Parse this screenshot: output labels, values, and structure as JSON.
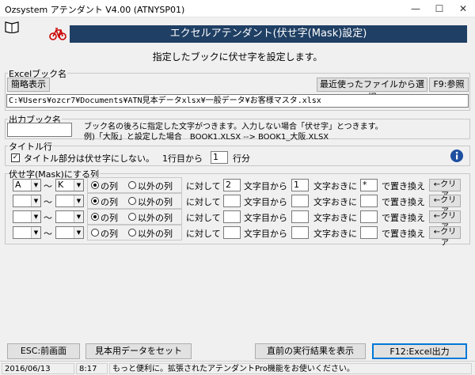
{
  "window": {
    "title": "Ozsystem アテンダント V4.00 (ATNYSP01)"
  },
  "banner": {
    "title": "エクセルアテンダント(伏せ字(Mask)設定)",
    "subtitle": "指定したブックに伏せ字を設定します。"
  },
  "excel_book": {
    "label": "Excelブック名",
    "simple_view_label": "簡略表示",
    "recent_label": "最近使ったファイルから選択",
    "browse_label": "F9:参照",
    "path": "C:¥Users¥ozcr7¥Documents¥ATN見本データxlsx¥一般データ¥お客様マスタ.xlsx"
  },
  "output_book": {
    "label": "出力ブック名",
    "value": "",
    "hint1": "ブック名の後ろに指定した文字がつきます。入力しない場合「伏せ字」とつきます。",
    "hint2": "例)「大阪」と設定した場合　BOOK1.XLSX --> BOOK1_大阪.XLSX"
  },
  "title_row": {
    "label": "タイトル行",
    "checkbox_label": "タイトル部分は伏せ字にしない。",
    "checked": true,
    "from_label": "1行目から",
    "rows_value": "1",
    "rows_unit": "行分"
  },
  "mask_columns": {
    "label": "伏せ字(Mask)にする列",
    "tilde": "～",
    "in_col_label": "の列",
    "outside_col_label": "以外の列",
    "target_label": "に対して",
    "from_char_label": "文字目から",
    "every_label": "文字おきに",
    "replace_label": "で置き換え",
    "clear_label": "←クリア",
    "rows": [
      {
        "from": "A",
        "to": "K",
        "mode": "in",
        "start": "2",
        "step": "1",
        "replace": "*"
      },
      {
        "from": "",
        "to": "",
        "mode": "in",
        "start": "",
        "step": "",
        "replace": ""
      },
      {
        "from": "",
        "to": "",
        "mode": "in",
        "start": "",
        "step": "",
        "replace": ""
      },
      {
        "from": "",
        "to": "",
        "mode": "none",
        "start": "",
        "step": "",
        "replace": ""
      }
    ]
  },
  "footer": {
    "back_label": "ESC:前画面",
    "sample_label": "見本用データをセット",
    "last_result_label": "直前の実行結果を表示",
    "export_label": "F12:Excel出力"
  },
  "status": {
    "date": "2016/06/13",
    "time": "8:17",
    "message": "もっと便利に。拡張されたアテンダントPro機能をお使いください。"
  },
  "icons": {
    "book": "book-icon",
    "bicycle": "bicycle-icon",
    "door": "exit-door-icon",
    "info": "info-icon"
  }
}
